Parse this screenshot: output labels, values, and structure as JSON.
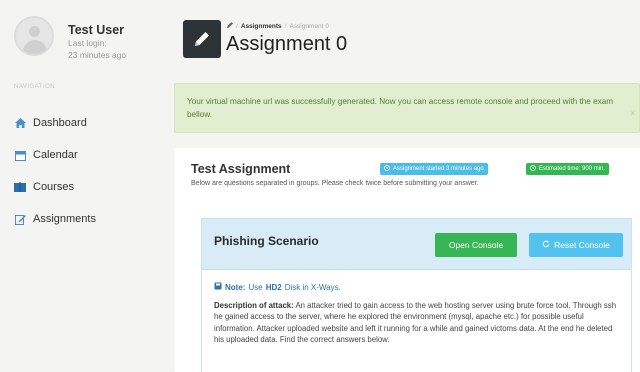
{
  "user": {
    "name": "Test User",
    "last_login_label": "Last login:",
    "last_login_value": "23 minutes ago"
  },
  "nav": {
    "heading": "Navigation",
    "items": [
      {
        "label": "Dashboard",
        "icon": "home-icon"
      },
      {
        "label": "Calendar",
        "icon": "calendar-icon"
      },
      {
        "label": "Courses",
        "icon": "book-icon"
      },
      {
        "label": "Assignments",
        "icon": "edit-icon"
      }
    ]
  },
  "header": {
    "icon": "pencil-icon",
    "breadcrumb": {
      "link": "Assignments",
      "separator": "/",
      "current": "Assignment 0"
    },
    "title": "Assignment 0"
  },
  "alert": {
    "text": "Your virtual machine url was successfully generated. Now you can access remote console and proceed with the exam bellow.",
    "close": "×"
  },
  "assignment": {
    "title": "Test Assignment",
    "subtitle": "Below are questions separated in groups. Please check twice before submitting your answer.",
    "started_badge": "Assignment started 3 minutes ago",
    "estimated_badge": "Estimated time: 900 min."
  },
  "scenario": {
    "title": "Phishing Scenario",
    "open_console": "Open Console",
    "reset_console": "Reset Console",
    "note_label": "Note:",
    "note_pre": "Use",
    "note_disk": "HD2",
    "note_post": "Disk in X-Ways.",
    "desc_label": "Description of attack:",
    "desc_text": "An attacker tried to gain access to the web hosting server using brute force tool. Through ssh he gained access to the server, where he explored the environment (mysql, apache etc.) for possible useful information. Attacker uploaded website and left it running for a while and gained victoms data. At the end he deleted his uploaded data. Find the correct answers below."
  },
  "colors": {
    "alert_bg": "#e1efd0",
    "badge_blue": "#4bbde6",
    "badge_green": "#33b753",
    "btn_green": "#37b655",
    "btn_blue": "#52c3ef",
    "header_icon_bg": "#2e3338"
  }
}
